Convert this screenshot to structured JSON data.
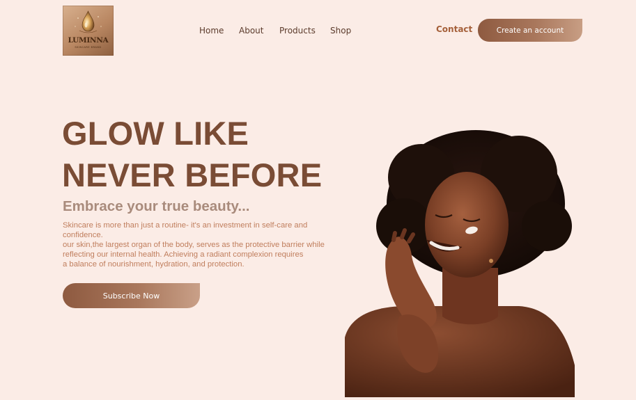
{
  "brand": {
    "logo_text": "LUMINNA",
    "logo_subtext": "SKINCARE BRAND"
  },
  "nav": {
    "items": [
      {
        "label": "Home"
      },
      {
        "label": "About"
      },
      {
        "label": "Products"
      },
      {
        "label": "Shop"
      }
    ],
    "contact_label": "Contact",
    "create_account_label": "Create an account"
  },
  "hero": {
    "title_line1": "GLOW LIKE",
    "title_line2": "NEVER BEFORE",
    "subtitle": "Embrace your true beauty...",
    "body_lines": [
      "Skincare is more than just a routine- it's an investment in self-care and",
      "confidence.",
      "our skin,the largest organ of the body, serves as the protective barrier while",
      "reflecting our internal health. Achieving a radiant complexion requires",
      "a balance of nourishment, hydration, and protection."
    ],
    "cta_label": "Subscribe Now"
  },
  "colors": {
    "background": "#fbece6",
    "title": "#7a4c35",
    "subtitle": "#a98b7c",
    "body": "#c07e5d",
    "accent": "#a5603a",
    "button_start": "#8e5a40",
    "button_end": "#c9a088"
  },
  "icons": {
    "logo_emblem": "droplet-icon",
    "hero_image": "woman-portrait-image"
  }
}
